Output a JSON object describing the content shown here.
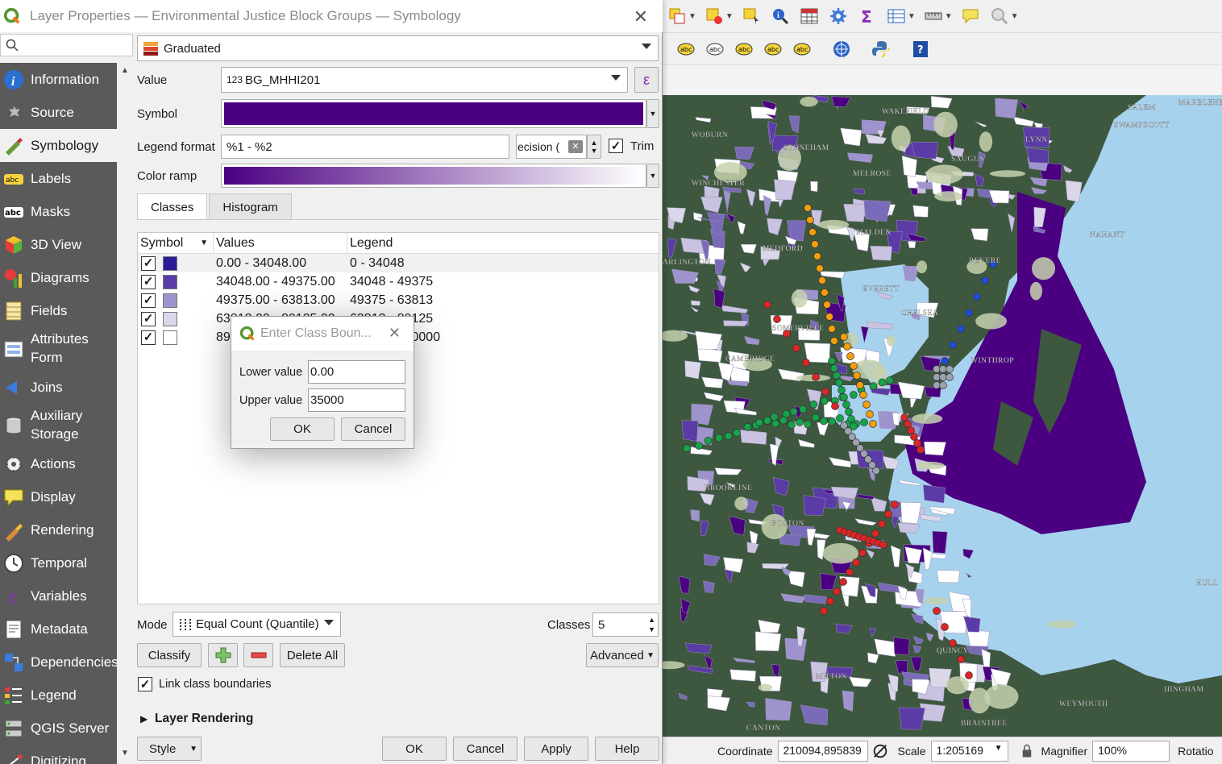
{
  "dialog": {
    "title": "Layer Properties — Environmental Justice Block Groups — Symbology",
    "close_glyph": "✕"
  },
  "nav": {
    "items": [
      {
        "label": "Information",
        "icon": "info-icon"
      },
      {
        "label": "Source",
        "icon": "source-icon"
      },
      {
        "label": "Symbology",
        "icon": "symbology-icon",
        "active": true
      },
      {
        "label": "Labels",
        "icon": "labels-icon"
      },
      {
        "label": "Masks",
        "icon": "masks-icon"
      },
      {
        "label": "3D View",
        "icon": "cube-icon"
      },
      {
        "label": "Diagrams",
        "icon": "diagram-icon"
      },
      {
        "label": "Fields",
        "icon": "fields-icon"
      },
      {
        "label": "Attributes Form",
        "icon": "form-icon"
      },
      {
        "label": "Joins",
        "icon": "joins-icon"
      },
      {
        "label": "Auxiliary Storage",
        "icon": "storage-icon"
      },
      {
        "label": "Actions",
        "icon": "actions-icon"
      },
      {
        "label": "Display",
        "icon": "display-icon"
      },
      {
        "label": "Rendering",
        "icon": "rendering-icon"
      },
      {
        "label": "Temporal",
        "icon": "clock-icon"
      },
      {
        "label": "Variables",
        "icon": "variables-icon"
      },
      {
        "label": "Metadata",
        "icon": "metadata-icon"
      },
      {
        "label": "Dependencies",
        "icon": "dependencies-icon"
      },
      {
        "label": "Legend",
        "icon": "legend-icon"
      },
      {
        "label": "QGIS Server",
        "icon": "server-icon"
      },
      {
        "label": "Digitizing",
        "icon": "digitizing-icon"
      }
    ]
  },
  "symbology": {
    "renderer": "Graduated",
    "value_label": "Value",
    "value_prefix": "123",
    "value_field": "BG_MHHI201",
    "expression_glyph": "ε",
    "symbol_label": "Symbol",
    "symbol_color": "#4b0082",
    "legend_format_label": "Legend format",
    "legend_format": "%1 - %2",
    "precision_text": "ecision (",
    "trim_label": "Trim",
    "color_ramp_label": "Color ramp",
    "ramp_from": "#4b0082",
    "ramp_to": "#ffffff",
    "tabs": [
      "Classes",
      "Histogram"
    ],
    "columns": [
      "Symbol",
      "Values",
      "Legend"
    ],
    "classes": [
      {
        "color": "#2b1a9a",
        "values": "0.00 - 34048.00",
        "legend": "0 - 34048"
      },
      {
        "color": "#5b3ba5",
        "values": "34048.00 - 49375.00",
        "legend": "34048 - 49375"
      },
      {
        "color": "#9e93cc",
        "values": "49375.00 - 63813.00",
        "legend": "49375 - 63813"
      },
      {
        "color": "#dad7ea",
        "values": "63813.00 - 89125.00",
        "legend": "63813 - 89125"
      },
      {
        "color": "#ffffff",
        "values": "89125.00 - 250000.00",
        "legend": "89125 - 250000"
      }
    ],
    "mode_label": "Mode",
    "mode_value": "Equal Count (Quantile)",
    "classes_label": "Classes",
    "classes_count": "5",
    "classify_label": "Classify",
    "delete_all_label": "Delete All",
    "advanced_label": "Advanced",
    "link_boundaries_label": "Link class boundaries",
    "layer_rendering_label": "Layer Rendering"
  },
  "footer": {
    "style_label": "Style",
    "ok_label": "OK",
    "cancel_label": "Cancel",
    "apply_label": "Apply",
    "help_label": "Help"
  },
  "class_dialog": {
    "title": "Enter Class Boun...",
    "lower_label": "Lower value",
    "lower_value": "0.00",
    "upper_label": "Upper value",
    "upper_value": "35000",
    "ok_label": "OK",
    "cancel_label": "Cancel"
  },
  "map": {
    "towns": [
      "WAKEFIELD",
      "SALEM",
      "MARBLEHEAD",
      "WOBURN",
      "LYNN",
      "SWAMPSCOTT",
      "STONEHAM",
      "SAUGUS",
      "WINCHESTER",
      "MELROSE",
      "NAHANT",
      "MALDEN",
      "MEDFORD",
      "ARLINGTON",
      "REVERE",
      "EVERETT",
      "CHELSEA",
      "SOMERVILLE",
      "WINTHROP",
      "CAMBRIDGE",
      "BROOKLINE",
      "BOSTON",
      "HULL",
      "QUINCY",
      "MILTON",
      "HINGHAM",
      "WEYMOUTH",
      "CANTON",
      "BRAINTREE"
    ]
  },
  "status": {
    "coordinate_label": "Coordinate",
    "coordinate_value": "210094,895839",
    "scale_label": "Scale",
    "scale_value": "1:205169",
    "magnifier_label": "Magnifier",
    "magnifier_value": "100%",
    "rotation_label": "Rotatio"
  }
}
